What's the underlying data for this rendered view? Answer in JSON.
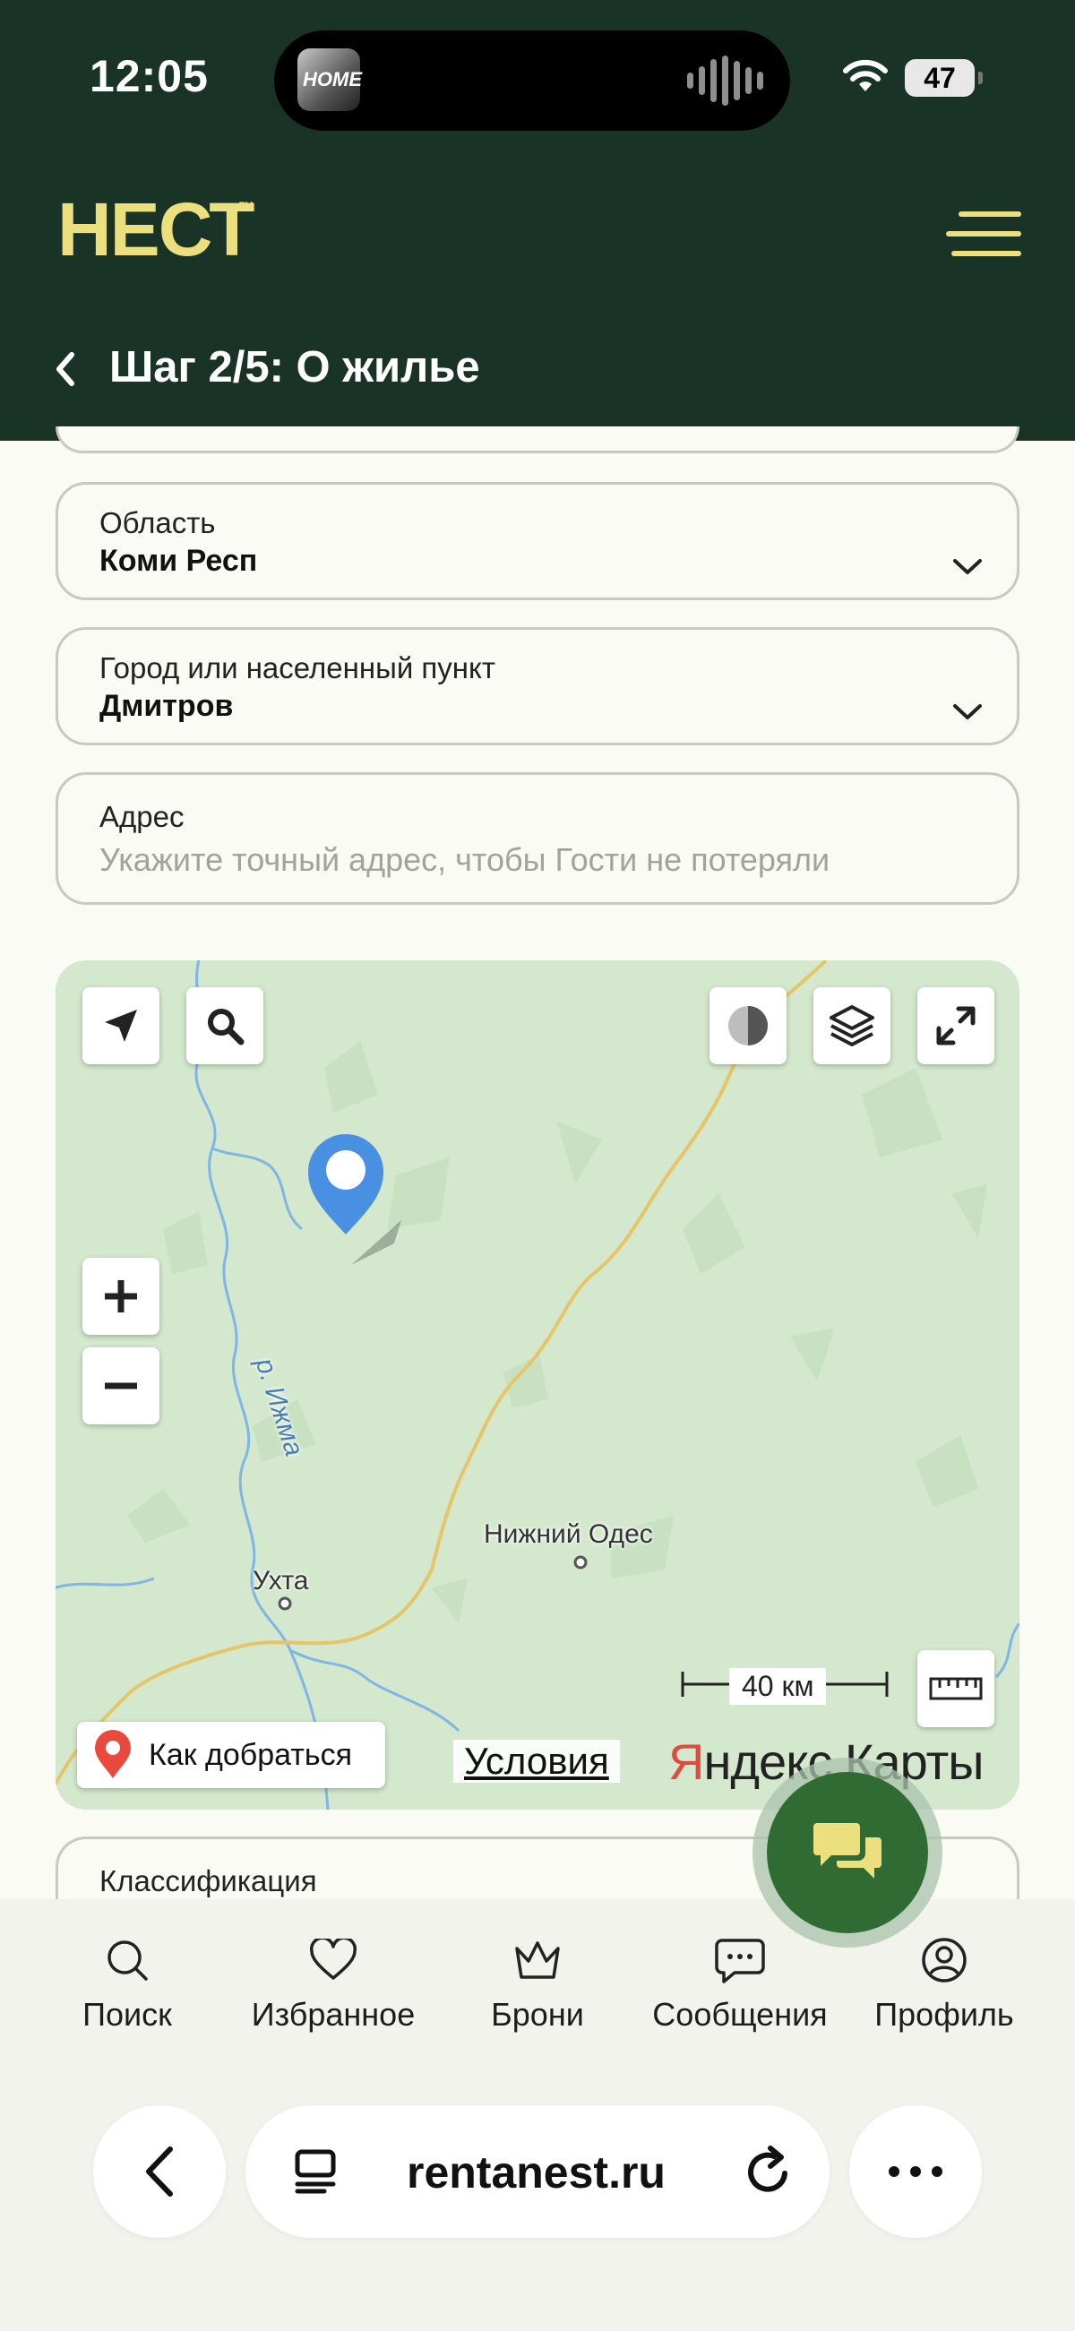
{
  "status_bar": {
    "time": "12:05",
    "battery": "47",
    "now_playing_art_text": "HOME"
  },
  "header": {
    "logo": "НЕСТ",
    "logo_mark": "™",
    "step_title": "Шаг 2/5: О жилье"
  },
  "form": {
    "region": {
      "label": "Область",
      "value": "Коми Респ"
    },
    "city": {
      "label": "Город или населенный пункт",
      "value": "Дмитров"
    },
    "address": {
      "label": "Адрес",
      "value": "",
      "placeholder": "Укажите точный адрес, чтобы Гости не потеряли"
    },
    "classification": {
      "label": "Классификация"
    }
  },
  "map": {
    "places": [
      "Нижний Одес",
      "Ухта"
    ],
    "river": "р. Ижма",
    "scale": "40 км",
    "route_button": "Как добраться",
    "terms_link": "Условия",
    "brand_first": "Я",
    "brand_rest": "ндекс Карты",
    "colors": {
      "land": "#d3e8cc",
      "river": "#7fb6e6",
      "road": "#e6c56a",
      "pin": "#4a90e2"
    }
  },
  "bottom_nav": [
    "Поиск",
    "Избранное",
    "Брони",
    "Сообщения",
    "Профиль"
  ],
  "browser": {
    "url": "rentanest.ru"
  },
  "colors": {
    "header_bg": "#1a3327",
    "accent": "#ecdf7e",
    "fab": "#2f6b33"
  }
}
